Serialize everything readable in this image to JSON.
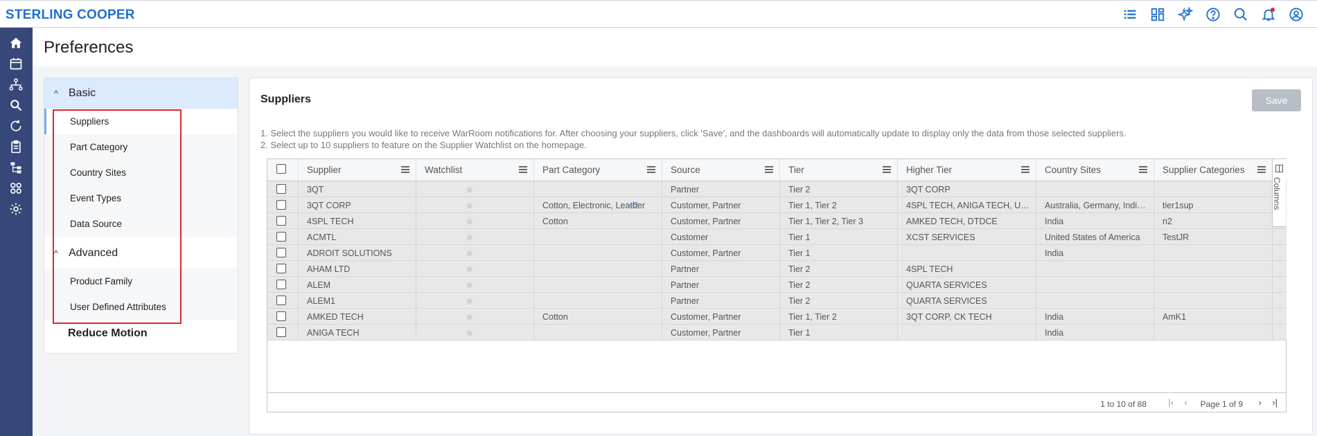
{
  "brand": "STERLING COOPER",
  "page": {
    "title": "Preferences"
  },
  "topbar_icons": [
    "list-icon",
    "dashboard-grid-icon",
    "sparkle-ai-icon",
    "help-icon",
    "search-icon",
    "bell-icon",
    "user-account-icon"
  ],
  "leftnav_icons": [
    "home-icon",
    "calendar-icon",
    "network-icon",
    "search-analytics-icon",
    "refresh-flow-icon",
    "clipboard-icon",
    "hierarchy-icon",
    "apps-icon",
    "settings-gear-icon"
  ],
  "preferences": {
    "basic_label": "Basic",
    "basic_items": [
      "Suppliers",
      "Part Category",
      "Country Sites",
      "Event Types",
      "Data Source"
    ],
    "advanced_label": "Advanced",
    "advanced_items": [
      "Product Family",
      "User Defined Attributes"
    ],
    "reduce_motion_label": "Reduce Motion",
    "active_item": "Suppliers"
  },
  "suppliers_panel": {
    "title": "Suppliers",
    "save_label": "Save",
    "instruction_1": "1. Select the suppliers you would like to receive WarRoom notifications for. After choosing your suppliers, click 'Save', and the dashboards will automatically update to display only the data from those selected suppliers.",
    "instruction_2": "2. Select up to 10 suppliers to feature on the Supplier Watchlist on the homepage."
  },
  "grid": {
    "columns": [
      "Supplier",
      "Watchlist",
      "Part Category",
      "Source",
      "Tier",
      "Higher Tier",
      "Country Sites",
      "Supplier Categories"
    ],
    "columns_tab_label": "Columns",
    "rows": [
      {
        "supplier": "3QT",
        "part_category": "",
        "part_more": "",
        "source": "Partner",
        "tier": "Tier 2",
        "higher_tier": "3QT CORP",
        "country_sites": "",
        "supplier_categories": ""
      },
      {
        "supplier": "3QT CORP",
        "part_category": "Cotton, Electronic, Leather",
        "part_more": "+2",
        "source": "Customer, Partner",
        "tier": "Tier 1, Tier 2",
        "higher_tier": "4SPL TECH, ANIGA TECH, UMB...",
        "country_sites": "Australia, Germany, India, ...",
        "supplier_categories": "tier1sup"
      },
      {
        "supplier": "4SPL TECH",
        "part_category": "Cotton",
        "part_more": "",
        "source": "Customer, Partner",
        "tier": "Tier 1, Tier 2, Tier 3",
        "higher_tier": "AMKED TECH, DTDCE",
        "country_sites": "India",
        "supplier_categories": "n2"
      },
      {
        "supplier": "ACMTL",
        "part_category": "",
        "part_more": "",
        "source": "Customer",
        "tier": "Tier 1",
        "higher_tier": "XCST SERVICES",
        "country_sites": "United States of America",
        "supplier_categories": "TestJR"
      },
      {
        "supplier": "ADROIT SOLUTIONS",
        "part_category": "",
        "part_more": "",
        "source": "Customer, Partner",
        "tier": "Tier 1",
        "higher_tier": "",
        "country_sites": "India",
        "supplier_categories": ""
      },
      {
        "supplier": "AHAM LTD",
        "part_category": "",
        "part_more": "",
        "source": "Partner",
        "tier": "Tier 2",
        "higher_tier": "4SPL TECH",
        "country_sites": "",
        "supplier_categories": ""
      },
      {
        "supplier": "ALEM",
        "part_category": "",
        "part_more": "",
        "source": "Partner",
        "tier": "Tier 2",
        "higher_tier": "QUARTA SERVICES",
        "country_sites": "",
        "supplier_categories": ""
      },
      {
        "supplier": "ALEM1",
        "part_category": "",
        "part_more": "",
        "source": "Partner",
        "tier": "Tier 2",
        "higher_tier": "QUARTA SERVICES",
        "country_sites": "",
        "supplier_categories": ""
      },
      {
        "supplier": "AMKED TECH",
        "part_category": "Cotton",
        "part_more": "",
        "source": "Customer, Partner",
        "tier": "Tier 1, Tier 2",
        "higher_tier": "3QT CORP, CK TECH",
        "country_sites": "India",
        "supplier_categories": "AmK1"
      },
      {
        "supplier": "ANIGA TECH",
        "part_category": "",
        "part_more": "",
        "source": "Customer, Partner",
        "tier": "Tier 1",
        "higher_tier": "",
        "country_sites": "India",
        "supplier_categories": ""
      }
    ]
  },
  "pagination": {
    "summary": "1 to 10 of 88",
    "page_text": "Page 1 of 9"
  }
}
